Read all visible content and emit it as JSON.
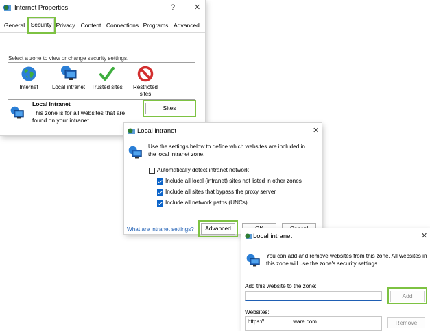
{
  "internet_properties": {
    "title": "Internet Properties",
    "help": "?",
    "close": "✕",
    "tabs": [
      "General",
      "Security",
      "Privacy",
      "Content",
      "Connections",
      "Programs",
      "Advanced"
    ],
    "instruction": "Select a zone to view or change security settings.",
    "zones": [
      {
        "label": "Internet",
        "icon": "globe-icon"
      },
      {
        "label": "Local intranet",
        "icon": "intranet-computer-icon"
      },
      {
        "label": "Trusted sites",
        "icon": "checkmark-icon"
      },
      {
        "label": "Restricted sites",
        "icon": "restricted-icon"
      }
    ],
    "zone_heading": "Local intranet",
    "zone_desc_line1": "This zone is for all websites that are",
    "zone_desc_line2": "found on your intranet.",
    "sites_button": "Sites"
  },
  "local_intranet_dialog": {
    "title": "Local intranet",
    "close": "✕",
    "desc_line1": "Use the settings below to define which websites are included in",
    "desc_line2": "the local intranet zone.",
    "options": [
      {
        "label": "Automatically detect intranet network",
        "checked": false
      },
      {
        "label": "Include all local (intranet) sites not listed in other zones",
        "checked": true
      },
      {
        "label": "Include all sites that bypass the proxy server",
        "checked": true
      },
      {
        "label": "Include all network paths (UNCs)",
        "checked": true
      }
    ],
    "help_link": "What are intranet settings?",
    "advanced_button": "Advanced",
    "ok_button": "OK",
    "cancel_button": "Cancel"
  },
  "local_intranet_sites": {
    "title": "Local intranet",
    "close": "✕",
    "desc_line1": "You can add and remove websites from this zone. All websites in",
    "desc_line2": "this zone will use the zone's security settings.",
    "add_label": "Add this website to the zone:",
    "add_value": "",
    "add_button": "Add",
    "websites_label": "Websites:",
    "websites": [
      "https://...................ware.com"
    ],
    "remove_button": "Remove"
  },
  "colors": {
    "highlight": "#7dc242",
    "link": "#1f5fb4",
    "checkbox": "#0a63c9"
  }
}
